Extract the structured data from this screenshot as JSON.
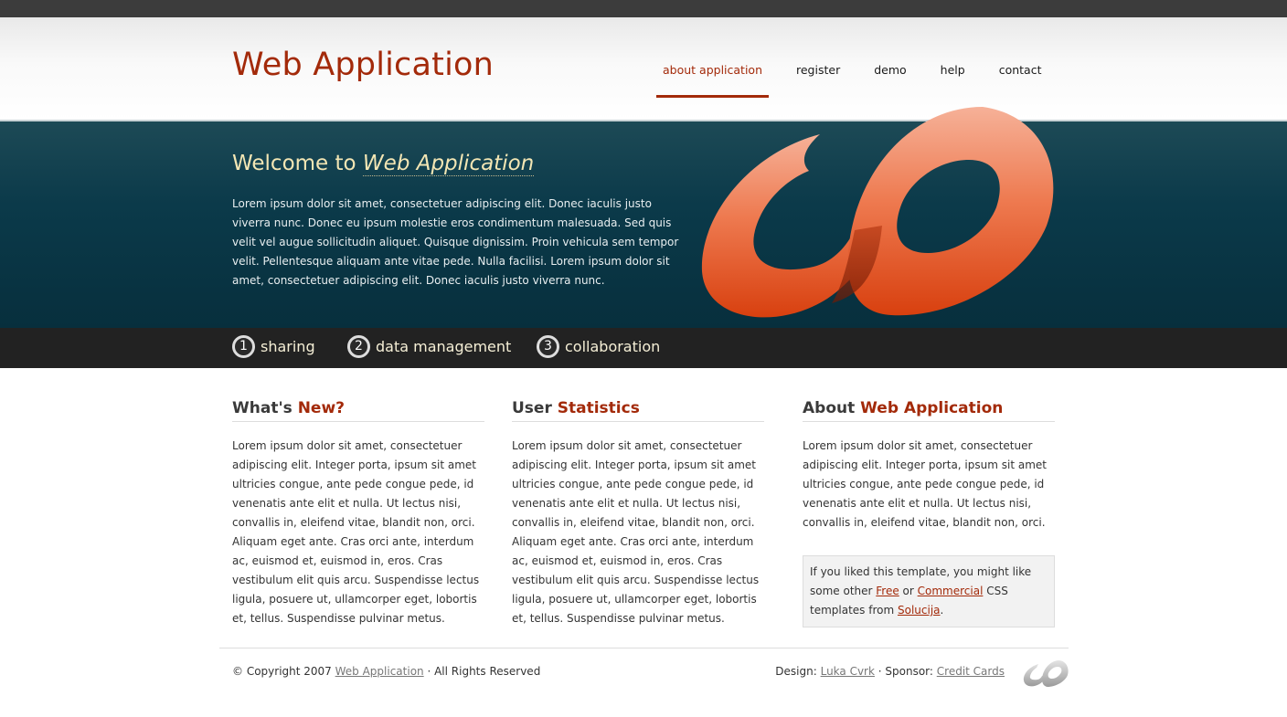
{
  "header": {
    "title": "Web Application",
    "nav": [
      {
        "label": "about application"
      },
      {
        "label": "register"
      },
      {
        "label": "demo"
      },
      {
        "label": "help"
      },
      {
        "label": "contact"
      }
    ]
  },
  "hero": {
    "welcome_prefix": "Welcome to ",
    "welcome_app": "Web Application",
    "text": "Lorem ipsum dolor sit amet, consectetuer adipiscing elit. Donec iaculis justo viverra nunc. Donec eu ipsum molestie eros condimentum malesuada. Sed quis velit vel augue sollicitudin aliquet. Quisque dignissim. Proin vehicula sem tempor velit. Pellentesque aliquam ante vitae pede. Nulla facilisi. Lorem ipsum dolor sit amet, consectetuer adipiscing elit. Donec iaculis justo viverra nunc.",
    "logo_icon": "infinity-logo-icon"
  },
  "features": [
    {
      "num": "1",
      "label": "sharing"
    },
    {
      "num": "2",
      "label": "data management"
    },
    {
      "num": "3",
      "label": "collaboration"
    }
  ],
  "columns": {
    "news": {
      "title_a": "What's ",
      "title_b": "New?",
      "text": "Lorem ipsum dolor sit amet, consectetuer adipiscing elit. Integer porta, ipsum sit amet ultricies congue, ante pede congue pede, id venenatis ante elit et nulla. Ut lectus nisi, convallis in, eleifend vitae, blandit non, orci. Aliquam eget ante. Cras orci ante, interdum ac, euismod et, euismod in, eros. Cras vestibulum elit quis arcu. Suspendisse lectus ligula, posuere ut, ullamcorper eget, lobortis et, tellus. Suspendisse pulvinar metus."
    },
    "stats": {
      "title_a": "User ",
      "title_b": "Statistics",
      "text": "Lorem ipsum dolor sit amet, consectetuer adipiscing elit. Integer porta, ipsum sit amet ultricies congue, ante pede congue pede, id venenatis ante elit et nulla. Ut lectus nisi, convallis in, eleifend vitae, blandit non, orci. Aliquam eget ante. Cras orci ante, interdum ac, euismod et, euismod in, eros. Cras vestibulum elit quis arcu. Suspendisse lectus ligula, posuere ut, ullamcorper eget, lobortis et, tellus. Suspendisse pulvinar metus."
    },
    "about": {
      "title_a": "About ",
      "title_b": "Web Application",
      "text": "Lorem ipsum dolor sit amet, consectetuer adipiscing elit. Integer porta, ipsum sit amet ultricies congue, ante pede congue pede, id venenatis ante elit et nulla. Ut lectus nisi, convallis in, eleifend vitae, blandit non, orci.",
      "promo_1": "If you liked this template, you might like some other ",
      "promo_free": "Free",
      "promo_or": " or ",
      "promo_commercial": "Commercial",
      "promo_2": " CSS templates from ",
      "promo_solucija": "Solucija",
      "promo_end": "."
    }
  },
  "footer": {
    "copyright": "© Copyright 2007 ",
    "app_link": "Web Application",
    "rights": " · All Rights Reserved",
    "design_label": "Design: ",
    "designer": "Luka Cvrk",
    "sponsor_label": " · Sponsor: ",
    "sponsor": "Credit Cards",
    "footer_icon": "infinity-logo-small-icon"
  },
  "colors": {
    "accent": "#a32a0a",
    "hero_bg": "#0b3a4a",
    "features_bg": "#222222",
    "logo_orange": "#e8522a"
  }
}
